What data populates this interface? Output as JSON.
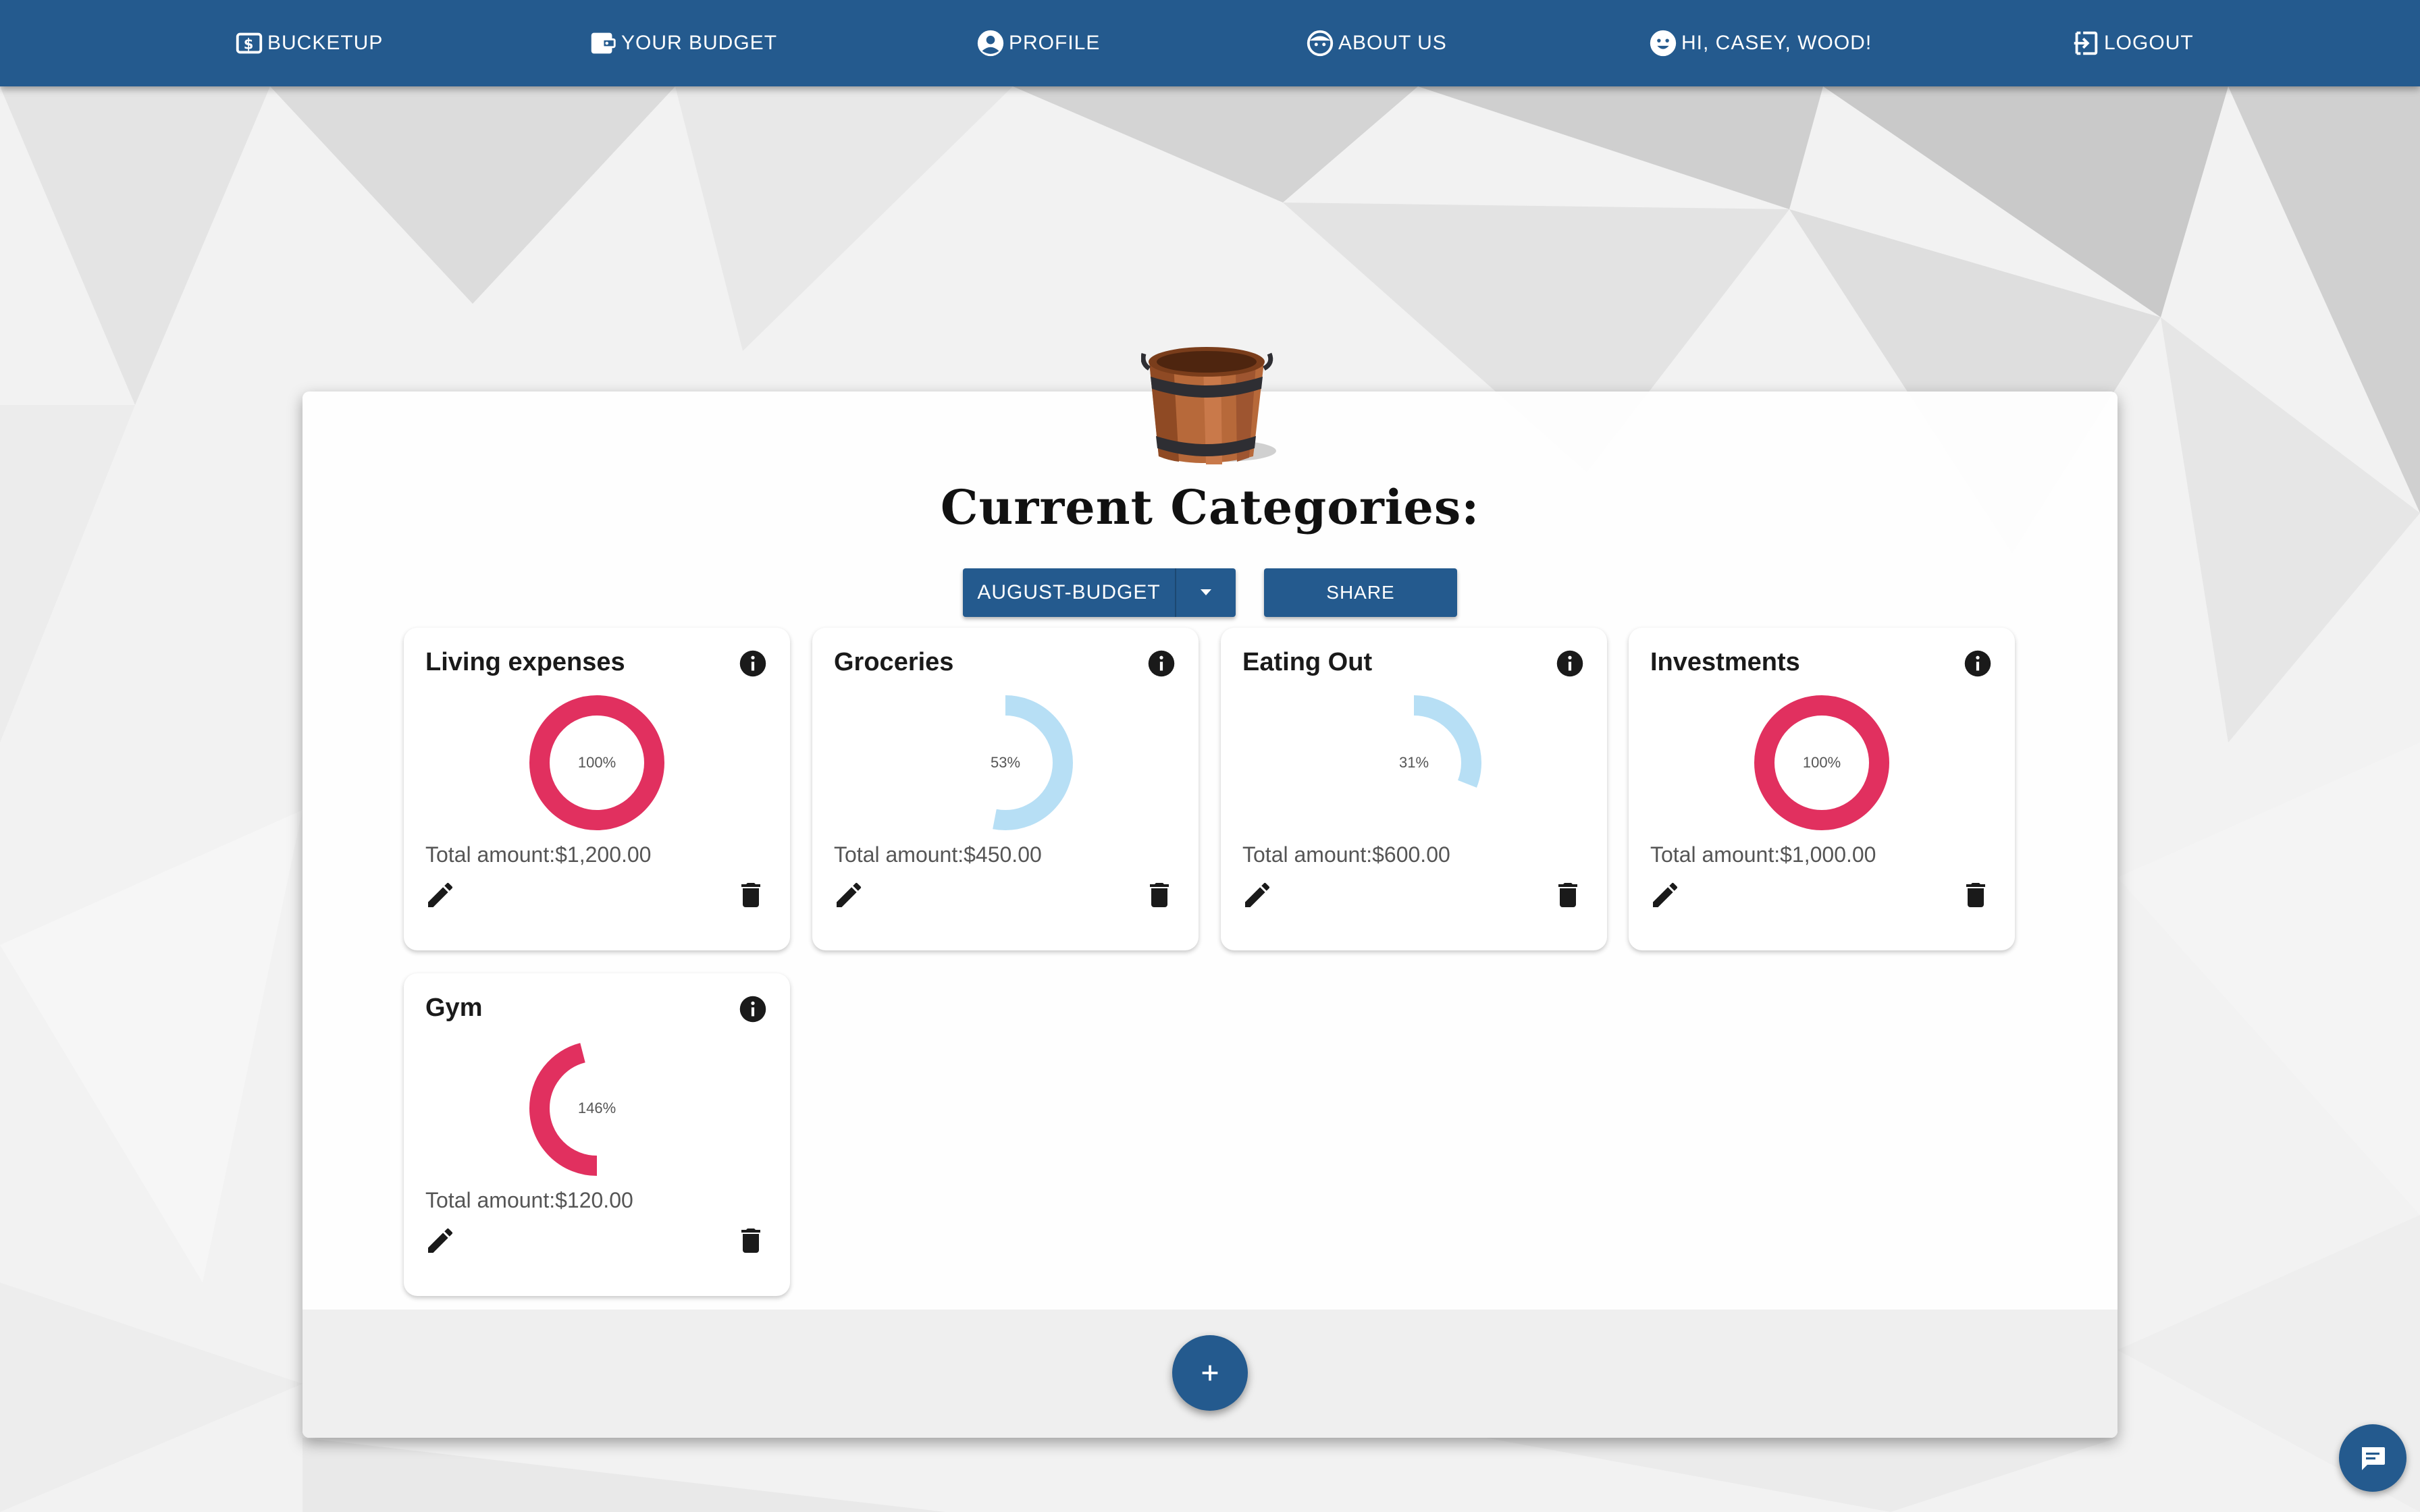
{
  "nav": {
    "brand": "BUCKETUP",
    "your_budget": "YOUR BUDGET",
    "profile": "PROFILE",
    "about": "ABOUT US",
    "greeting": "HI, CASEY, WOOD!",
    "logout": "LOGOUT"
  },
  "main": {
    "title": "Current Categories:",
    "budget_select": "AUGUST-BUDGET",
    "share_label": "SHARE"
  },
  "categories": [
    {
      "name": "Living expenses",
      "percent_label": "100%",
      "percent": 100,
      "total": "Total amount:$1,200.00",
      "color": "#e1305f"
    },
    {
      "name": "Groceries",
      "percent_label": "53%",
      "percent": 53,
      "total": "Total amount:$450.00",
      "color": "#b7dff5"
    },
    {
      "name": "Eating Out",
      "percent_label": "31%",
      "percent": 31,
      "total": "Total amount:$600.00",
      "color": "#b7dff5"
    },
    {
      "name": "Investments",
      "percent_label": "100%",
      "percent": 100,
      "total": "Total amount:$1,000.00",
      "color": "#e1305f"
    },
    {
      "name": "Gym",
      "percent_label": "146%",
      "percent": 146,
      "total": "Total amount:$120.00",
      "color": "#e1305f"
    }
  ],
  "colors": {
    "primary": "#245a8e",
    "over_budget": "#e1305f",
    "under_budget": "#b7dff5"
  },
  "icons": {
    "brand": "dollar-icon",
    "your_budget": "wallet-icon",
    "profile": "account-circle-icon",
    "about": "face-icon",
    "greeting": "smiley-icon",
    "logout": "logout-icon",
    "info": "info-icon",
    "edit": "pencil-icon",
    "delete": "trash-icon",
    "add": "plus-icon",
    "chat": "chat-icon"
  }
}
